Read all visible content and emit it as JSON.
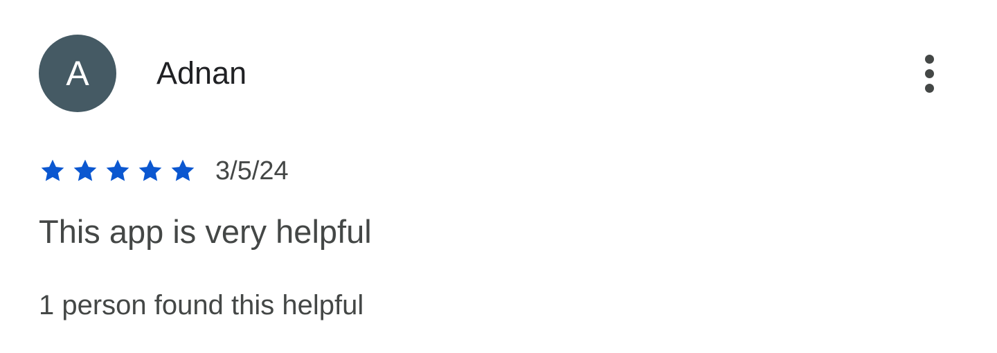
{
  "review": {
    "avatar_letter": "A",
    "avatar_color": "#455a64",
    "author": "Adnan",
    "rating": 5,
    "rating_max": 5,
    "star_color": "#0b57d0",
    "date": "3/5/24",
    "text": "This app is very helpful",
    "helpful_text": "1 person found this helpful",
    "menu_icon": "more-vert-icon"
  }
}
